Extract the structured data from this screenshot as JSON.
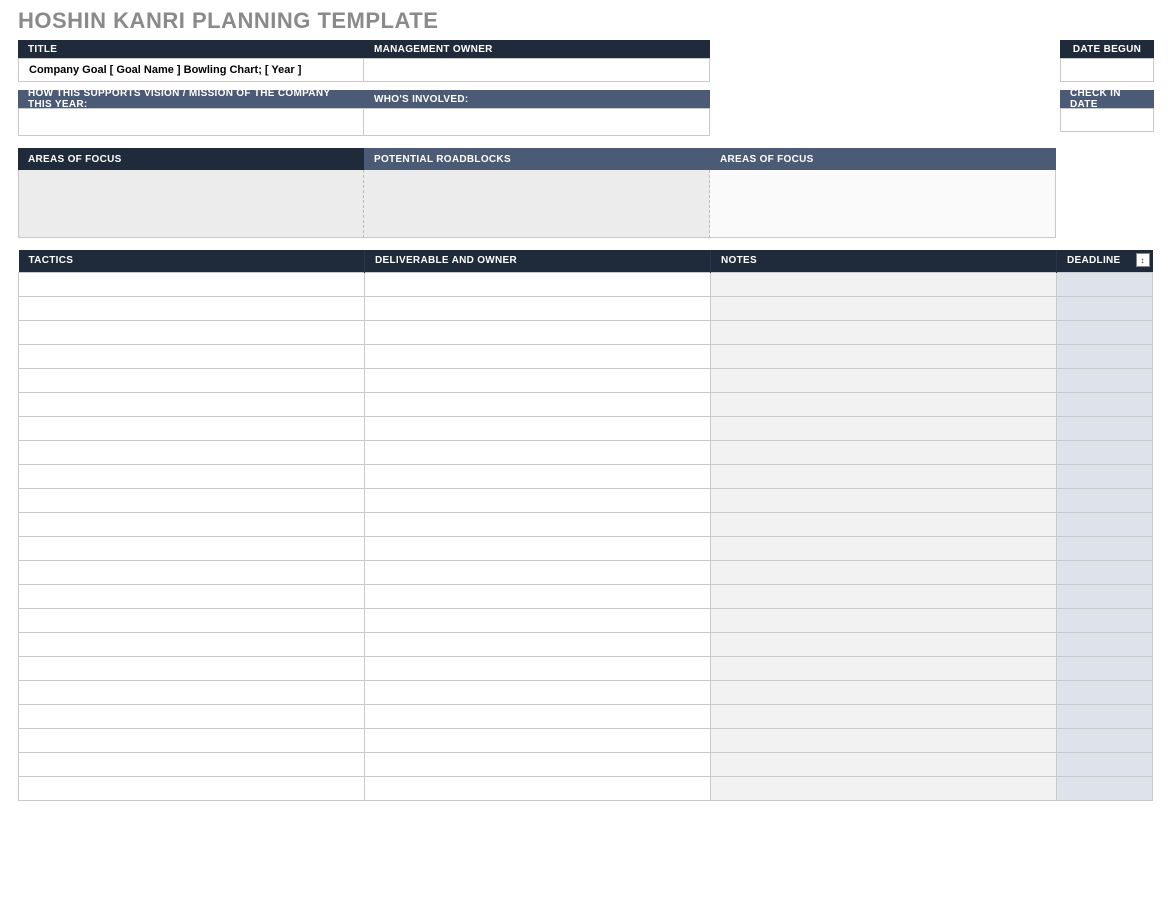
{
  "title": "HOSHIN KANRI PLANNING TEMPLATE",
  "section1": {
    "title_header": "TITLE",
    "mgmt_header": "MANAGEMENT OWNER",
    "title_value": "Company Goal [ Goal Name ] Bowling Chart; [ Year ]",
    "mgmt_value": "",
    "date_begun_header": "DATE BEGUN",
    "date_begun_value": "",
    "checkin_header": "CHECK IN DATE",
    "checkin_value": ""
  },
  "section2": {
    "support_header": "HOW THIS SUPPORTS VISION / MISSION OF THE COMPANY THIS YEAR:",
    "involved_header": "WHO'S INVOLVED:",
    "support_value": "",
    "involved_value": ""
  },
  "section3": {
    "areas_header": "AREAS OF FOCUS",
    "roadblocks_header": "POTENTIAL ROADBLOCKS",
    "areas2_header": "AREAS OF FOCUS",
    "areas_value": "",
    "roadblocks_value": "",
    "areas2_value": ""
  },
  "tactics": {
    "headers": {
      "tactics": "TACTICS",
      "deliverable": "DELIVERABLE AND OWNER",
      "notes": "NOTES",
      "deadline": "DEADLINE"
    },
    "rows": 22
  }
}
